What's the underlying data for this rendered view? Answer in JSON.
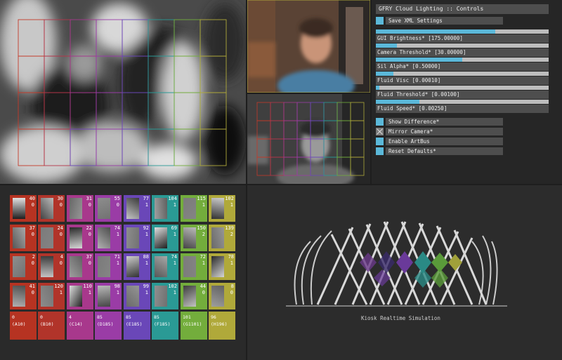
{
  "gui": {
    "title": "GFRY Cloud Lighting :: Controls",
    "save_label": "Save XML Settings",
    "sliders": [
      {
        "label": "GUI Brightness* [175.00000]",
        "value": 0.69
      },
      {
        "label": "Camera Threshold* [30.00000]",
        "value": 0.12
      },
      {
        "label": "Sil Alpha* [0.50000]",
        "value": 0.5
      },
      {
        "label": "Fluid Visc [0.00010]",
        "value": 0.1
      },
      {
        "label": "Fluid Threshold* [0.00100]",
        "value": 0.02
      },
      {
        "label": "Fluid Speed* [0.00250]",
        "value": 0.25
      }
    ],
    "toggles": [
      {
        "label": "Show Difference*",
        "checked": false
      },
      {
        "label": "Mirror Camera*",
        "checked": true
      },
      {
        "label": "Enable ArtBus",
        "checked": false
      },
      {
        "label": "Reset Defaults*",
        "checked": false
      }
    ]
  },
  "grid": {
    "cells": [
      [
        "40",
        "0"
      ],
      [
        "30",
        "0"
      ],
      [
        "31",
        "0"
      ],
      [
        "55",
        "0"
      ],
      [
        "77",
        "1"
      ],
      [
        "104",
        "1"
      ],
      [
        "115",
        "1"
      ],
      [
        "102",
        "1"
      ],
      [
        "37",
        "0"
      ],
      [
        "24",
        "0"
      ],
      [
        "22",
        "0"
      ],
      [
        "74",
        "1"
      ],
      [
        "92",
        "1"
      ],
      [
        "69",
        "1"
      ],
      [
        "150",
        "2"
      ],
      [
        "139",
        "2"
      ],
      [
        "2",
        "0"
      ],
      [
        "4",
        "0"
      ],
      [
        "37",
        "0"
      ],
      [
        "71",
        "1"
      ],
      [
        "88",
        "1"
      ],
      [
        "74",
        "1"
      ],
      [
        "72",
        "1"
      ],
      [
        "78",
        "1"
      ],
      [
        "41",
        "0"
      ],
      [
        "120",
        "1"
      ],
      [
        "110",
        "1"
      ],
      [
        "98",
        "1"
      ],
      [
        "99",
        "1"
      ],
      [
        "102",
        "1"
      ],
      [
        "44",
        "0"
      ],
      [
        "8",
        "0"
      ]
    ],
    "bottom": [
      [
        "0",
        "(A10)"
      ],
      [
        "0",
        "(B10)"
      ],
      [
        "4",
        "(C14)"
      ],
      [
        "85",
        "(D185)"
      ],
      [
        "85",
        "(E185)"
      ],
      [
        "85",
        "(F185)"
      ],
      [
        "101",
        "(G1101)"
      ],
      [
        "96",
        "(H196)"
      ]
    ],
    "colors": [
      "#b63322",
      "#b1342a",
      "#a8388c",
      "#9a3ca6",
      "#6a47b8",
      "#2a9a95",
      "#73ad3c",
      "#b0a93a"
    ]
  },
  "sim": {
    "label": "Kiosk Realtime Simulation"
  }
}
